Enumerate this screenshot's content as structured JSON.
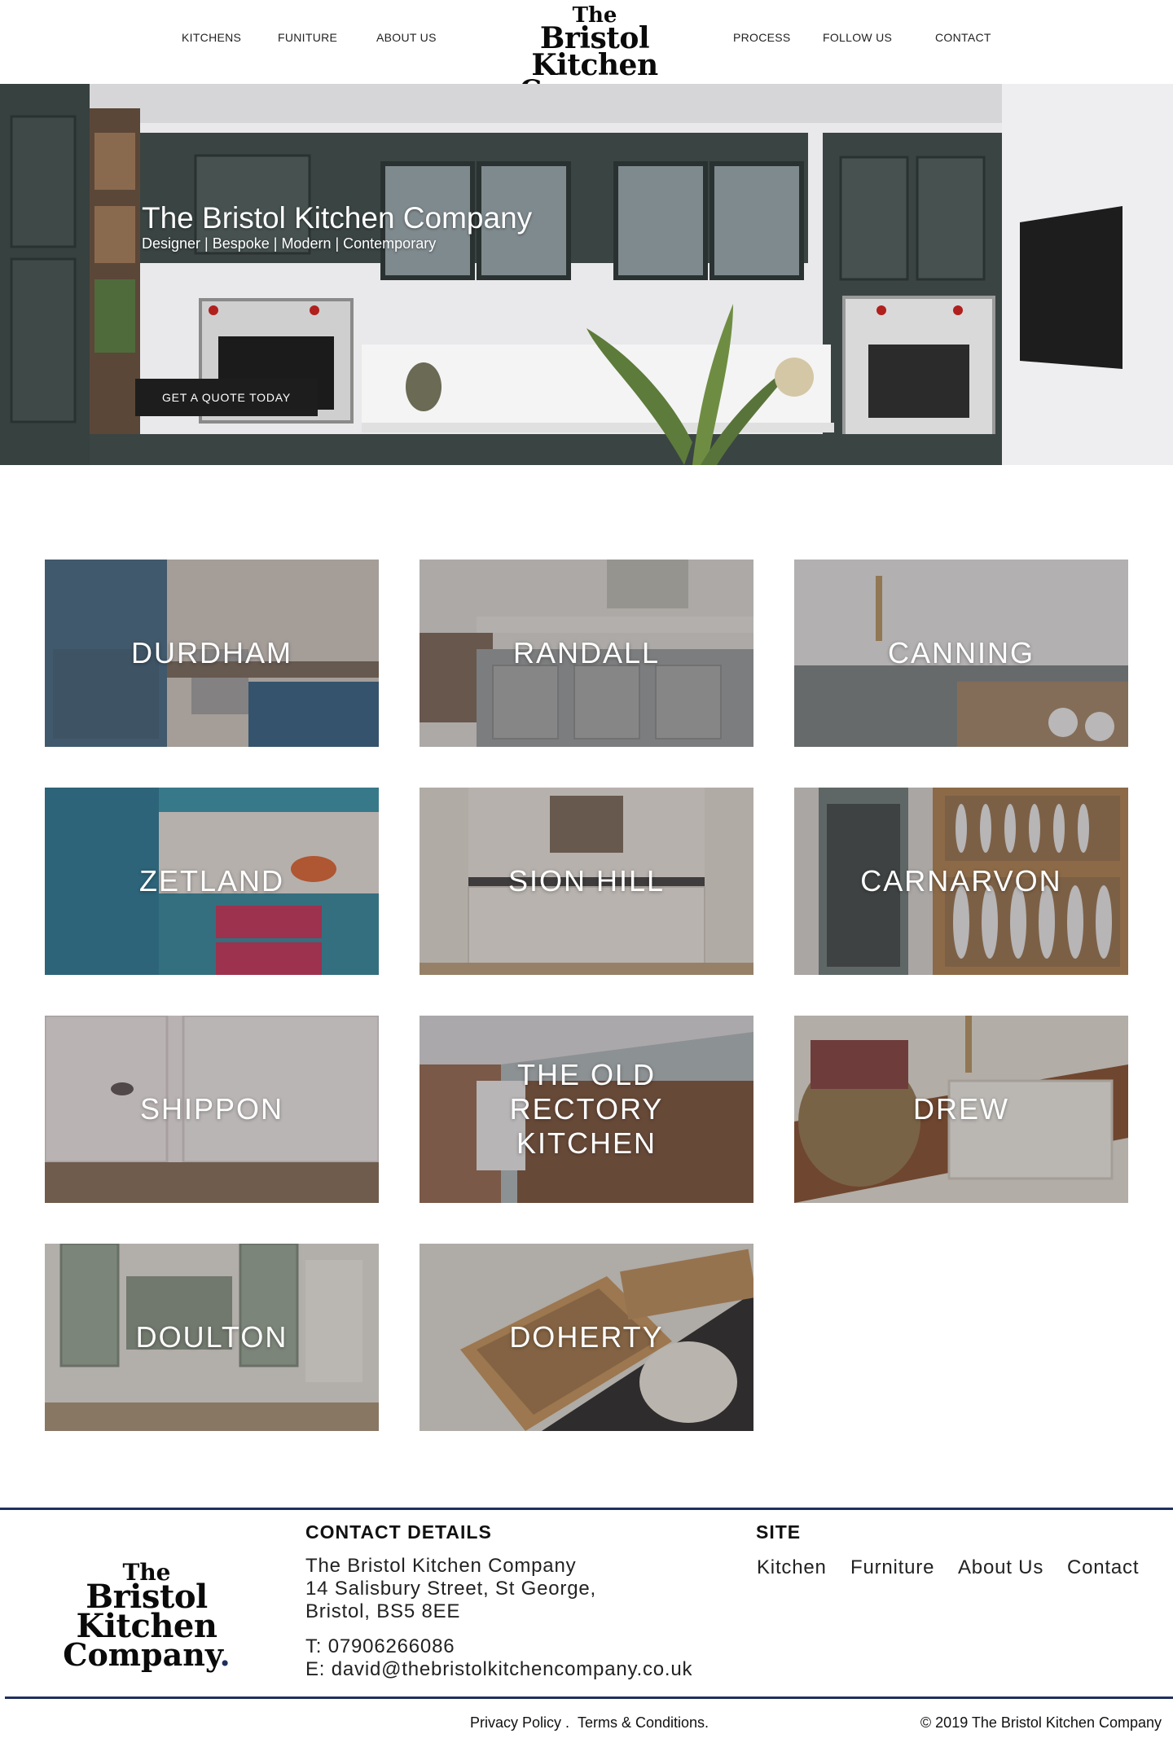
{
  "nav": {
    "left": [
      "KITCHENS",
      "FUNITURE",
      "ABOUT US"
    ],
    "right": [
      "PROCESS",
      "FOLLOW US",
      "CONTACT"
    ]
  },
  "logo": {
    "line1": "The",
    "line2": "Bristol Kitchen",
    "line3": "Company",
    "dot": "."
  },
  "hero": {
    "title": "The Bristol Kitchen Company",
    "subtitle": "Designer | Bespoke | Modern | Contemporary",
    "cta": "GET A QUOTE TODAY"
  },
  "projects": [
    "DURDHAM",
    "RANDALL",
    "CANNING",
    "ZETLAND",
    "SION HILL",
    "CARNARVON",
    "SHIPPON",
    "THE OLD RECTORY KITCHEN",
    "DREW",
    "DOULTON",
    "DOHERTY"
  ],
  "footer": {
    "contact_heading": "CONTACT DETAILS",
    "company": "The Bristol Kitchen Company",
    "address1": "14 Salisbury Street, St George,",
    "address2": "Bristol, BS5 8EE",
    "phone": "T: 07906266086",
    "email": "E: david@thebristolkitchencompany.co.uk",
    "site_heading": "SITE",
    "site_links": [
      "Kitchen",
      "Furniture",
      "About Us",
      "Contact"
    ],
    "privacy": "Privacy Policy .",
    "terms": "Terms & Conditions.",
    "copyright": "© 2019 The Bristol Kitchen Company"
  },
  "colors": {
    "accent_navy": "#1f2f5e",
    "cabinet_green": "#3b4542",
    "cta_bg": "#1d1d1d"
  }
}
